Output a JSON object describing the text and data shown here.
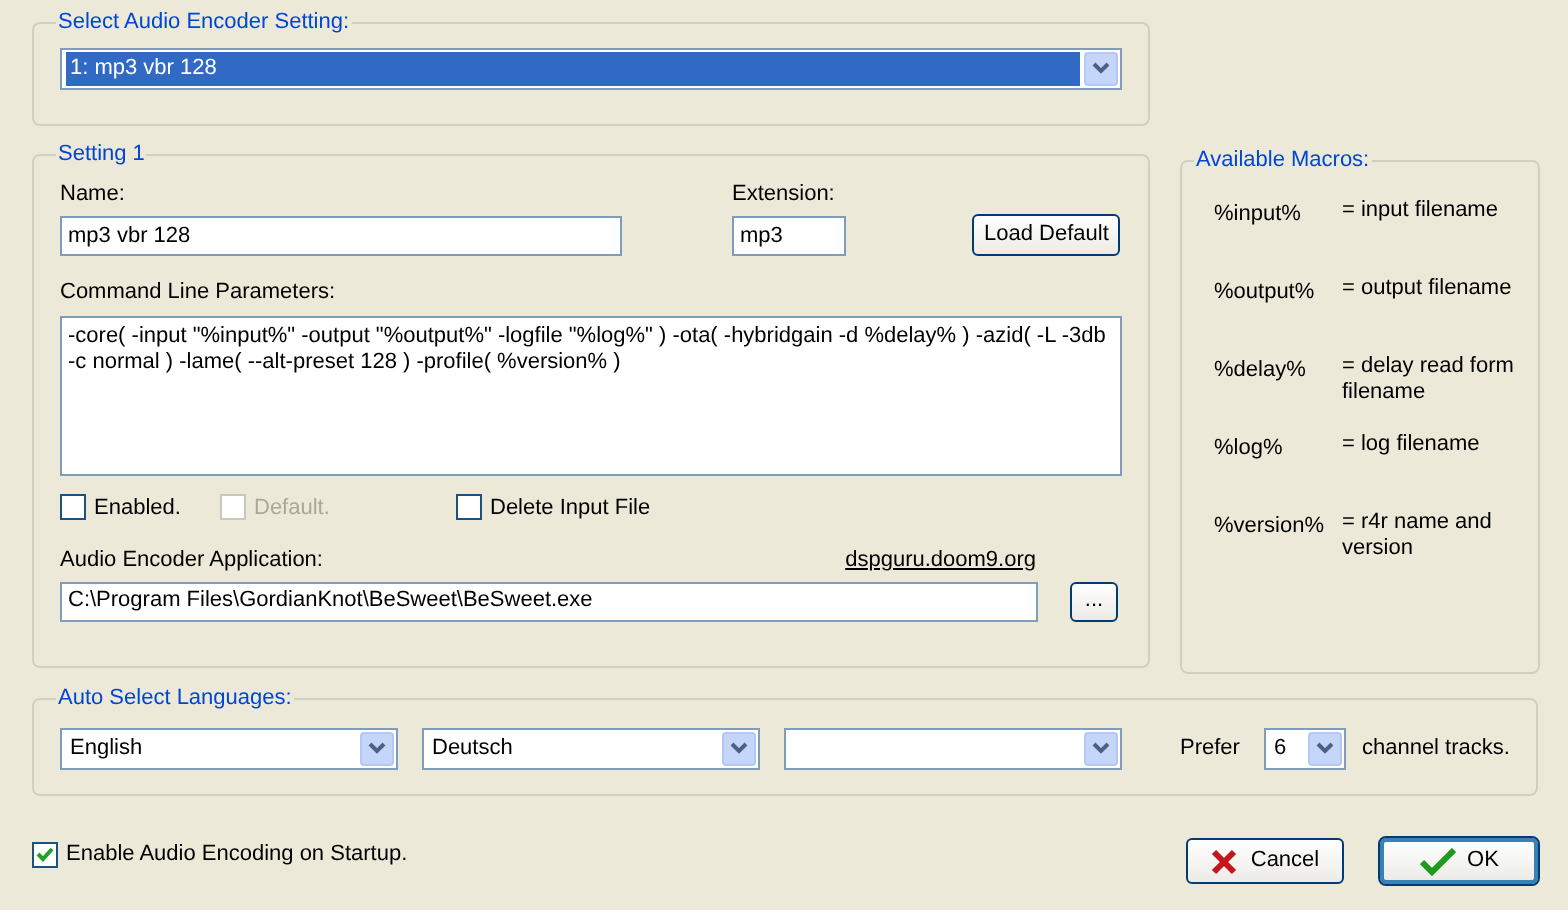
{
  "encoder_select": {
    "title": "Select Audio Encoder Setting:",
    "value": "1: mp3 vbr 128",
    "highlighted": true
  },
  "setting": {
    "title": "Setting 1",
    "name_label": "Name:",
    "name_value": "mp3 vbr 128",
    "extension_label": "Extension:",
    "extension_value": "mp3",
    "load_default_button": "Load Default",
    "params_label": "Command Line Parameters:",
    "params_value": "-core( -input \"%input%\" -output \"%output%\" -logfile \"%log%\" ) -ota( -hybridgain -d %delay% ) -azid( -L -3db -c normal ) -lame( --alt-preset 128 ) -profile( %version% )",
    "checkboxes": [
      {
        "label": "Enabled.",
        "checked": false,
        "disabled": false
      },
      {
        "label": "Default.",
        "checked": false,
        "disabled": true
      },
      {
        "label": "Delete Input File",
        "checked": false,
        "disabled": false
      }
    ],
    "app_label": "Audio Encoder Application:",
    "app_link": "dspguru.doom9.org",
    "app_path": "C:\\Program Files\\GordianKnot\\BeSweet\\BeSweet.exe",
    "browse_button": "..."
  },
  "macros": {
    "title": "Available Macros:",
    "items": [
      {
        "macro": "%input%",
        "description": "= input filename"
      },
      {
        "macro": "%output%",
        "description": "= output filename"
      },
      {
        "macro": "%delay%",
        "description": "= delay read form filename"
      },
      {
        "macro": "%log%",
        "description": "= log filename"
      },
      {
        "macro": "%version%",
        "description": "= r4r name and version"
      }
    ]
  },
  "languages": {
    "title": "Auto Select Languages:",
    "selects": [
      {
        "kind": "filled",
        "value": "English"
      },
      {
        "kind": "filled",
        "value": "Deutsch"
      },
      {
        "kind": "empty"
      }
    ],
    "prefer_label": "Prefer",
    "channels_value": "6",
    "channels_suffix": "channel tracks."
  },
  "startup_checkbox": {
    "label": "Enable Audio Encoding on Startup.",
    "checked": true
  },
  "buttons": [
    {
      "kind": "cancel",
      "label": "Cancel",
      "default": false
    },
    {
      "kind": "ok",
      "label": "OK",
      "default": true
    }
  ]
}
